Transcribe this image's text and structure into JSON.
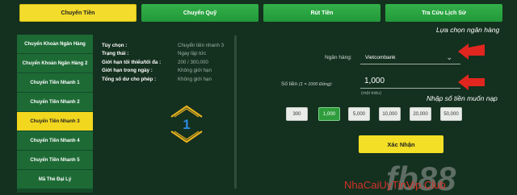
{
  "tabs": [
    {
      "label": "Chuyển Tiền",
      "active": true
    },
    {
      "label": "Chuyển Quỹ",
      "active": false
    },
    {
      "label": "Rút Tiền",
      "active": false
    },
    {
      "label": "Tra Cứu Lịch Sử",
      "active": false
    }
  ],
  "sidebar": {
    "items": [
      {
        "label": "Chuyển Khoản Ngân Hàng"
      },
      {
        "label": "Chuyển Khoản Ngân Hàng 2"
      },
      {
        "label": "Chuyển Tiền Nhanh 1"
      },
      {
        "label": "Chuyển Tiền Nhanh 2"
      },
      {
        "label": "Chuyển Tiền Nhanh 3",
        "active": true
      },
      {
        "label": "Chuyển Tiền Nhanh 4"
      },
      {
        "label": "Chuyển Tiền Nhanh 5"
      },
      {
        "label": "Mã Thẻ Đại Lý"
      }
    ]
  },
  "info": [
    {
      "key": "Tùy chọn :",
      "value": "Chuyển tiền nhanh 3"
    },
    {
      "key": "Trạng thái :",
      "value": "Ngay lập tức"
    },
    {
      "key": "Giới hạn tối thiểu/tối đa :",
      "value": "200 / 300,000"
    },
    {
      "key": "Giới hạn trong ngày :",
      "value": "Không giới hạn"
    },
    {
      "key": "Tổng số dư cho phép :",
      "value": "Không giới hạn"
    }
  ],
  "step": {
    "number": "1"
  },
  "form": {
    "bank_label": "Ngân hàng:",
    "bank_value": "Vietcombank",
    "amount_label": "Số tiền",
    "amount_unit": "(1 = 1000 Đồng):",
    "amount_value": "1,000",
    "amount_hint": "(một triệu)",
    "quick_amounts": [
      "300",
      "1,000",
      "5,000",
      "10,000",
      "20,000",
      "50,000"
    ],
    "selected_amount": "1,000",
    "submit_label": "Xác Nhận"
  },
  "annotations": {
    "bank_note": "Lựa chọn ngân hàng",
    "amount_note": "Nhập số tiền muốn nạp"
  },
  "watermark": {
    "brand": "fb88",
    "site": "NhaCaiUyTinVip.Club"
  },
  "colors": {
    "background": "#14301f",
    "accent_yellow": "#f3dc2b",
    "tab_green": "#2aa541",
    "arrow_red": "#e0261f"
  }
}
